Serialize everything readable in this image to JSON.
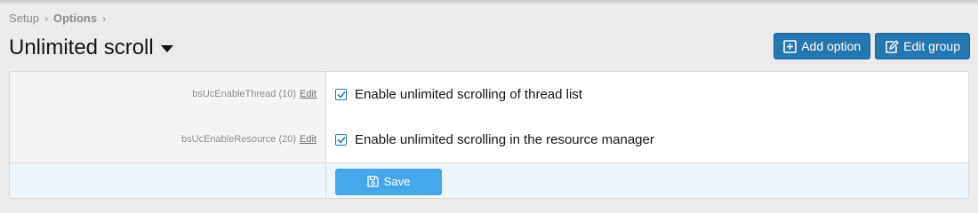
{
  "breadcrumb": {
    "items": [
      {
        "label": "Setup"
      },
      {
        "label": "Options"
      }
    ]
  },
  "header": {
    "title": "Unlimited scroll"
  },
  "toolbar": {
    "add_option_label": "Add option",
    "edit_group_label": "Edit group"
  },
  "options": [
    {
      "key": "bsUcEnableThread",
      "order": "(10)",
      "edit_label": "Edit",
      "checked": true,
      "description": "Enable unlimited scrolling of thread list"
    },
    {
      "key": "bsUcEnableResource",
      "order": "(20)",
      "edit_label": "Edit",
      "checked": true,
      "description": "Enable unlimited scrolling in the resource manager"
    }
  ],
  "form": {
    "save_label": "Save"
  },
  "colors": {
    "primary_button": "#2577b1",
    "save_button": "#47a7eb",
    "checkbox": "#2577b1"
  }
}
